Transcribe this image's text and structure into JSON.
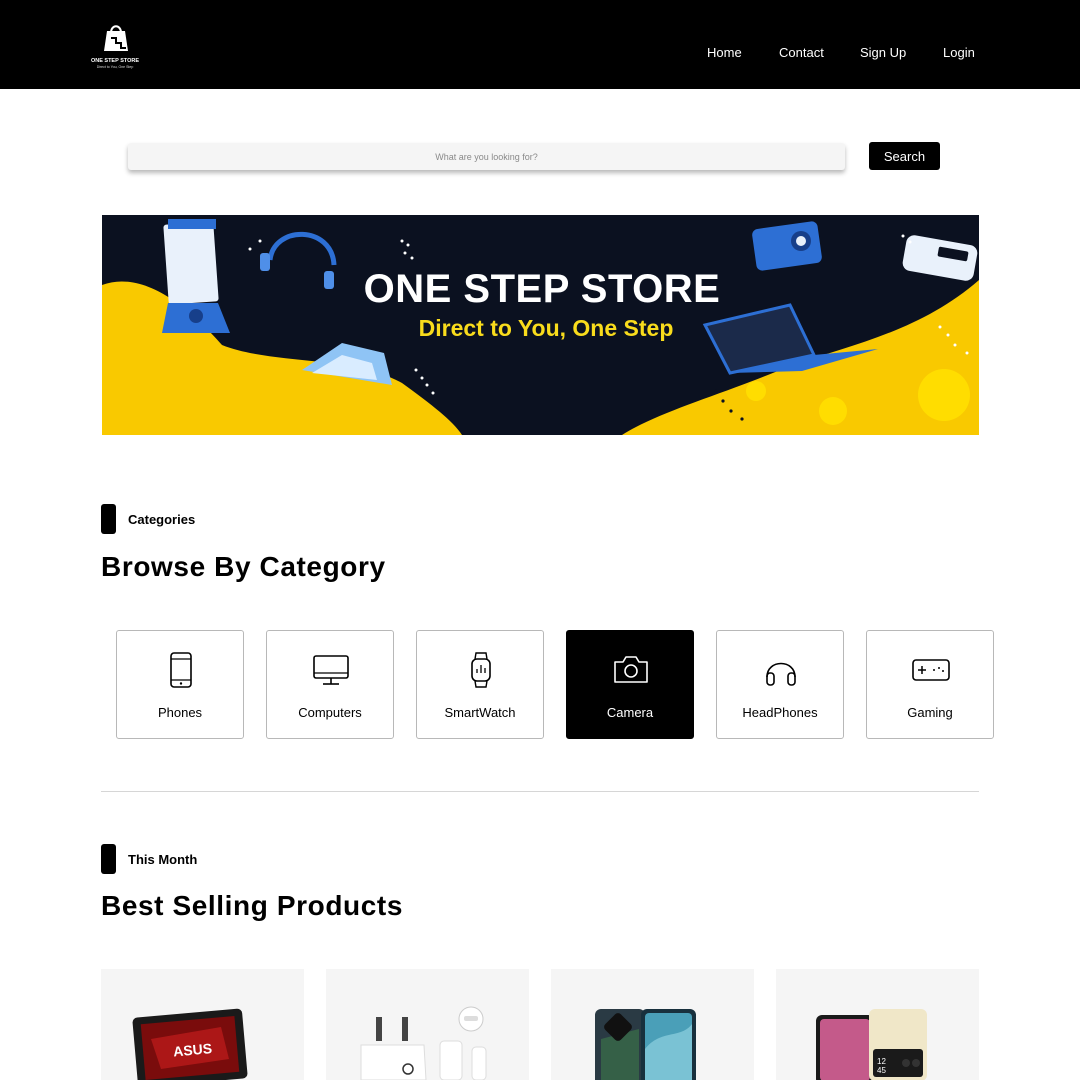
{
  "header": {
    "logo_name": "ONE STEP STORE",
    "logo_tagline": "Direct to You, One Step",
    "nav": [
      "Home",
      "Contact",
      "Sign Up",
      "Login"
    ]
  },
  "search": {
    "placeholder": "What are you looking for?",
    "button_label": "Search"
  },
  "banner": {
    "title": "ONE STEP STORE",
    "subtitle": "Direct to You, One Step"
  },
  "categories": {
    "tag": "Categories",
    "title": "Browse By Category",
    "items": [
      {
        "label": "Phones",
        "icon": "phone-icon"
      },
      {
        "label": "Computers",
        "icon": "computer-icon"
      },
      {
        "label": "SmartWatch",
        "icon": "smartwatch-icon"
      },
      {
        "label": "Camera",
        "icon": "camera-icon",
        "selected": true
      },
      {
        "label": "HeadPhones",
        "icon": "headphones-icon"
      },
      {
        "label": "Gaming",
        "icon": "gamepad-icon"
      }
    ]
  },
  "best_selling": {
    "tag": "This Month",
    "title": "Best Selling Products",
    "products": [
      {
        "image": "asus-laptop"
      },
      {
        "image": "charger-adapter"
      },
      {
        "image": "smartphone-pair"
      },
      {
        "image": "flip-phone"
      }
    ]
  },
  "colors": {
    "header_bg": "#000000",
    "banner_bg": "#0b1120",
    "banner_accent": "#f9c900",
    "subtitle_yellow": "#f9dc1c",
    "card_bg": "#f5f5f5"
  }
}
